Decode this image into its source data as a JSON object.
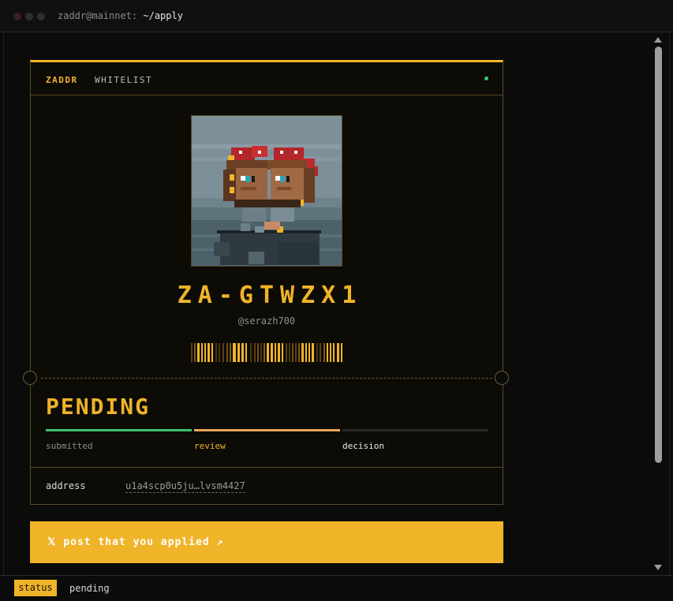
{
  "window": {
    "title_prefix": "zaddr@mainnet:",
    "title_path": " ~/apply"
  },
  "card": {
    "brand": "ZADDR",
    "section": "WHITELIST",
    "token_id": "ZA-GTWZX1",
    "handle": "@serazh700",
    "status": "PENDING",
    "steps": [
      {
        "label": "submitted",
        "state": "done"
      },
      {
        "label": "review",
        "state": "active"
      },
      {
        "label": "decision",
        "state": "upcoming"
      }
    ],
    "address_label": "address",
    "address_value": "u1a4scp0u5ju…lvsm4427"
  },
  "cta": {
    "label": "𝕏  post that you applied ↗"
  },
  "statusbar": {
    "chip": "status",
    "text": "pending"
  },
  "colors": {
    "accent": "#f0b429",
    "done": "#3cc36a",
    "active": "#e8a85a",
    "online": "#37c871"
  }
}
